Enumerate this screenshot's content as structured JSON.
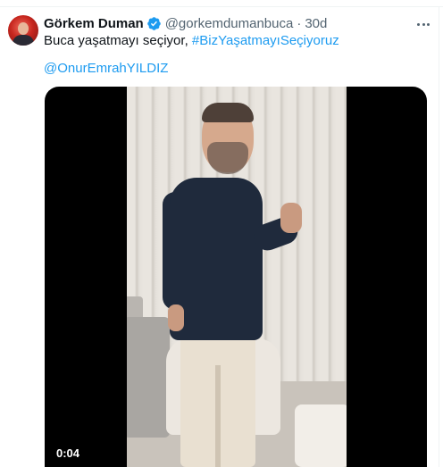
{
  "tweet": {
    "display_name": "Görkem Duman",
    "verified_icon": "verified-badge-icon",
    "handle": "@gorkemdumanbuca",
    "separator": "·",
    "time": "30d",
    "text_plain": "Buca yaşatmayı seçiyor, ",
    "hashtag": "#BizYaşatmayıSeçiyoruz",
    "mention": "@OnurEmrahYILDIZ",
    "more_icon": "more-dots-icon"
  },
  "video": {
    "timestamp": "0:04"
  },
  "colors": {
    "link": "#1d9bf0",
    "secondary_text": "#536471",
    "verified": "#1d9bf0"
  }
}
